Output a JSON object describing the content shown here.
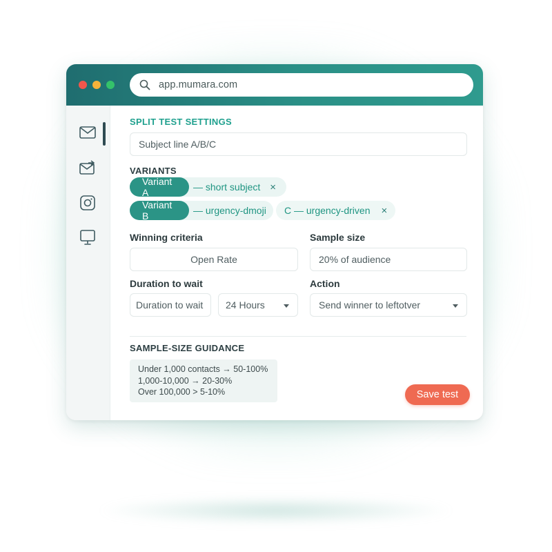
{
  "browser": {
    "url": "app.mumara.com"
  },
  "sidebar": {
    "items": [
      {
        "icon": "mail-icon",
        "active": true
      },
      {
        "icon": "mail-forward-icon",
        "active": false
      },
      {
        "icon": "instagram-icon",
        "active": false
      },
      {
        "icon": "monitor-icon",
        "active": false
      }
    ]
  },
  "split_test": {
    "title": "SPLIT TEST SETTINGS",
    "test_type_value": "Subject line A/B/C"
  },
  "variants": {
    "title": "VARIANTS",
    "items": [
      {
        "pill": "Variant A",
        "text": "— short subject",
        "close": "×"
      },
      {
        "pill": "Variant B",
        "text": "— urgency-dmoji"
      },
      {
        "text": "C — urgency-driven",
        "close": "×"
      }
    ]
  },
  "winning_criteria": {
    "label": "Winning criteria",
    "value": "Open Rate"
  },
  "sample_size": {
    "label": "Sample size",
    "value": "20% of audience"
  },
  "duration": {
    "label": "Duration to wait",
    "field_value": "Duration to wait",
    "select_value": "24 Hours"
  },
  "action": {
    "label": "Action",
    "value": "Send winner to leftotver"
  },
  "guidance": {
    "title": "SAMPLE-SIZE GUIDANCE",
    "lines": [
      "Under 1,000 contacts → 50-100%",
      "1,000-10,000 → 20-30%",
      "Over 100,000 > 5-10%"
    ]
  },
  "footer": {
    "save_label": "Save test"
  },
  "colors": {
    "accent": "#2b9486",
    "titlebar": "#2a8f86",
    "save": "#ef6a52"
  }
}
